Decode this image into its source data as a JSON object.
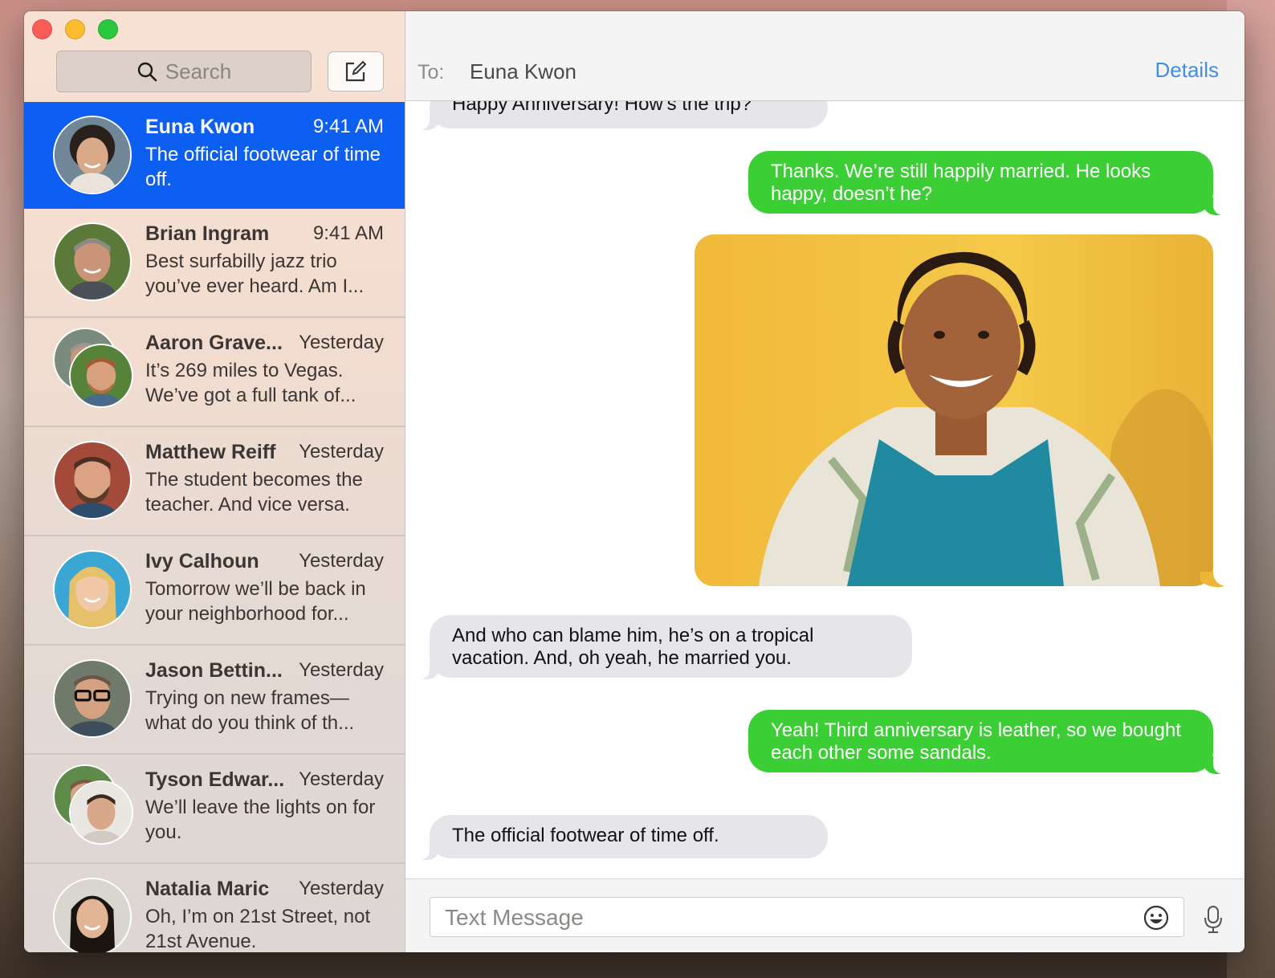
{
  "sidebar": {
    "search_placeholder": "Search",
    "conversations": [
      {
        "name": "Euna Kwon",
        "time": "9:41 AM",
        "preview": "The official footwear of time off.",
        "selected": true
      },
      {
        "name": "Brian Ingram",
        "time": "9:41 AM",
        "preview": "Best surfabilly jazz trio you’ve ever heard. Am I...",
        "selected": false
      },
      {
        "name": "Aaron Grave...",
        "time": "Yesterday",
        "preview": "It’s 269 miles to Vegas. We’ve got a full tank of...",
        "selected": false
      },
      {
        "name": "Matthew Reiff",
        "time": "Yesterday",
        "preview": "The student becomes the teacher. And vice versa.",
        "selected": false
      },
      {
        "name": "Ivy Calhoun",
        "time": "Yesterday",
        "preview": "Tomorrow we’ll be back in your neighborhood for...",
        "selected": false
      },
      {
        "name": "Jason Bettin...",
        "time": "Yesterday",
        "preview": "Trying on new frames— what do you think of th...",
        "selected": false
      },
      {
        "name": "Tyson Edwar...",
        "time": "Yesterday",
        "preview": "We’ll leave the lights on for you.",
        "selected": false
      },
      {
        "name": "Natalia Maric",
        "time": "Yesterday",
        "preview": "Oh, I’m on 21st Street, not 21st Avenue.",
        "selected": false
      }
    ]
  },
  "header": {
    "to_label": "To:",
    "recipient": "Euna Kwon",
    "details_label": "Details"
  },
  "thread": {
    "messages": [
      {
        "direction": "incoming",
        "text": "Happy Anniversary! How’s the trip?"
      },
      {
        "direction": "outgoing",
        "text": "Thanks. We’re still happily married. He looks happy, doesn’t he?"
      },
      {
        "direction": "outgoing",
        "type": "photo"
      },
      {
        "direction": "incoming",
        "text": "And who can blame him, he’s on a tropical vacation. And, oh yeah, he married you."
      },
      {
        "direction": "outgoing",
        "text": "Yeah! Third anniversary is leather, so we bought each other some sandals."
      },
      {
        "direction": "incoming",
        "text": "The official footwear of time off."
      }
    ]
  },
  "composer": {
    "placeholder": "Text Message",
    "emoji_icon": "smiley-icon",
    "mic_icon": "microphone-icon"
  },
  "colors": {
    "selected_row": "#0d5ff2",
    "outgoing_bubble": "#3ccf35",
    "incoming_bubble": "#e5e5ea",
    "details_link": "#3f8eeb"
  }
}
